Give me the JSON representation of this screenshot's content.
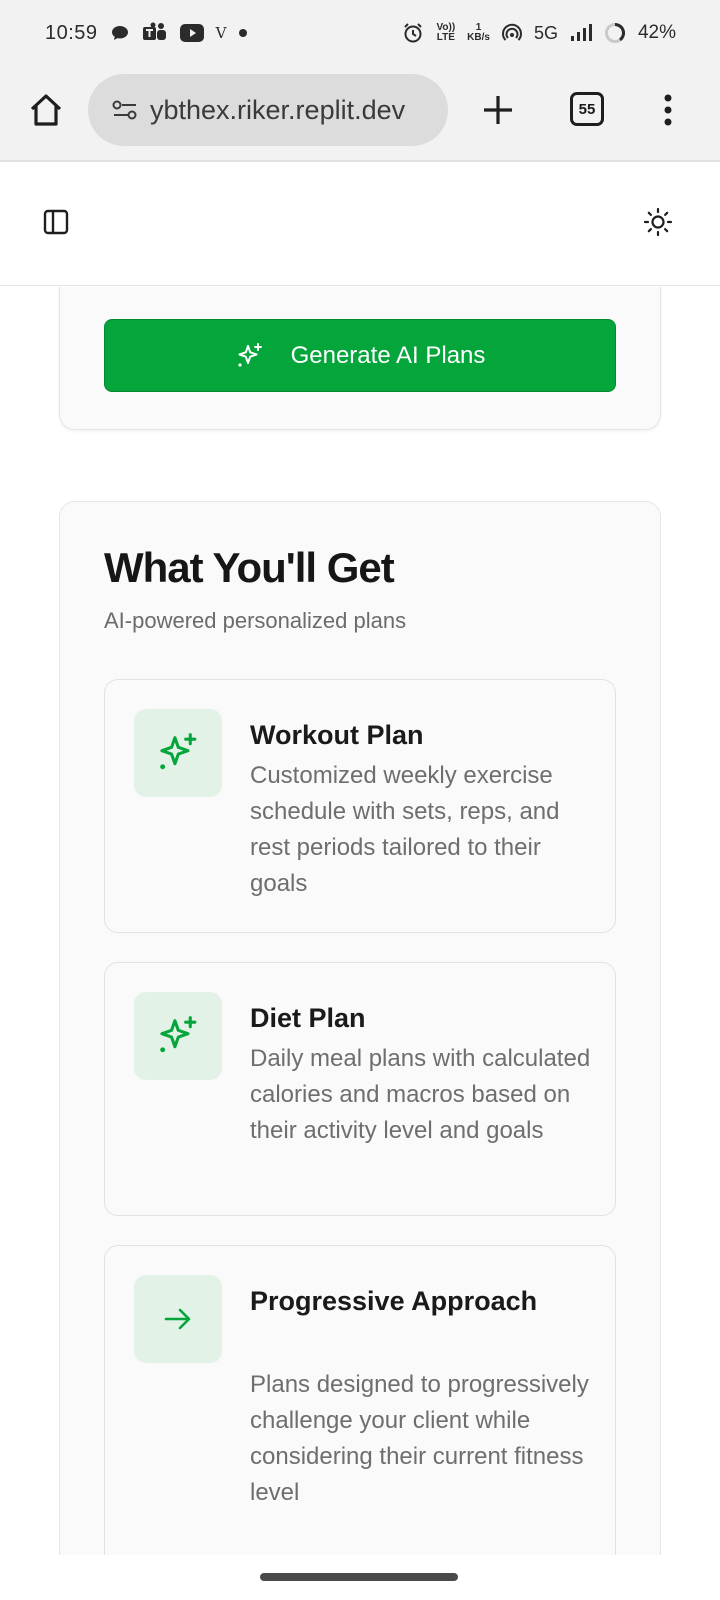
{
  "status_bar": {
    "time": "10:59",
    "network_speed_value": "1",
    "network_speed_unit": "KB/s",
    "network_type": "5G",
    "volte_top": "Vo))",
    "volte_bottom": "LTE",
    "carrier_letter": "V",
    "battery": "42%"
  },
  "browser": {
    "url_host": "ybthex.riker.replit.dev",
    "tab_count": "55"
  },
  "generate_button": {
    "label": "Generate AI Plans"
  },
  "section": {
    "title": "What You'll Get",
    "subtitle": "AI-powered personalized plans"
  },
  "features": [
    {
      "title": "Workout Plan",
      "description": "Customized weekly exercise schedule with sets, reps, and rest periods tailored to their goals",
      "icon": "sparkles-icon"
    },
    {
      "title": "Diet Plan",
      "description": "Daily meal plans with calculated calories and macros based on their activity level and goals",
      "icon": "sparkles-icon"
    },
    {
      "title": "Progressive Approach",
      "description": "Plans designed to progressively challenge your client while considering their current fitness level",
      "icon": "arrow-right-icon"
    }
  ],
  "colors": {
    "accent_green": "#04a63c",
    "icon_bg": "#e2f2e6",
    "muted_text": "#6e6e6e"
  }
}
